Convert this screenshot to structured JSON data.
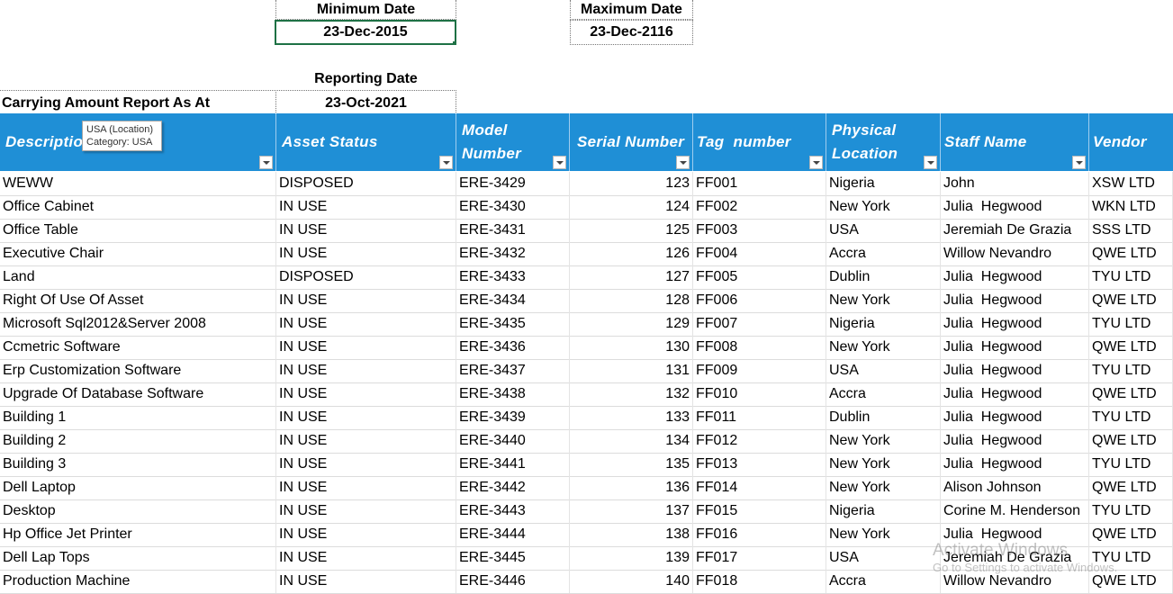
{
  "summary": {
    "min_date_label": "Minimum Date",
    "min_date_value": "23-Dec-2015",
    "max_date_label": "Maximum Date",
    "max_date_value": "23-Dec-2116",
    "reporting_date_label": "Reporting Date",
    "report_title": "Carrying Amount Report As At",
    "reporting_date_value": "23-Oct-2021"
  },
  "table": {
    "columns": [
      "Description",
      "Asset Status",
      "Model Number",
      "Serial Number",
      "Tag  number",
      "Physical Location",
      "Staff Name",
      "Vendor"
    ],
    "rows": [
      [
        "WEWW",
        "DISPOSED",
        "ERE-3429",
        "123",
        "FF001",
        "Nigeria",
        "John",
        "XSW LTD"
      ],
      [
        "Office Cabinet",
        "IN USE",
        "ERE-3430",
        "124",
        "FF002",
        "New York",
        "Julia  Hegwood",
        "WKN LTD"
      ],
      [
        "Office Table",
        "IN USE",
        "ERE-3431",
        "125",
        "FF003",
        "USA",
        "Jeremiah De Grazia",
        "SSS LTD"
      ],
      [
        "Executive Chair",
        "IN USE",
        "ERE-3432",
        "126",
        "FF004",
        "Accra",
        "Willow Nevandro",
        "QWE LTD"
      ],
      [
        "Land",
        "DISPOSED",
        "ERE-3433",
        "127",
        "FF005",
        "Dublin",
        "Julia  Hegwood",
        "TYU LTD"
      ],
      [
        "Right Of Use Of Asset",
        "IN USE",
        "ERE-3434",
        "128",
        "FF006",
        "New York",
        "Julia  Hegwood",
        "QWE LTD"
      ],
      [
        "Microsoft Sql2012&Server 2008",
        "IN USE",
        "ERE-3435",
        "129",
        "FF007",
        "Nigeria",
        "Julia  Hegwood",
        "TYU LTD"
      ],
      [
        "Ccmetric Software",
        "IN USE",
        "ERE-3436",
        "130",
        "FF008",
        "New York",
        "Julia  Hegwood",
        "QWE LTD"
      ],
      [
        "Erp Customization Software",
        "IN USE",
        "ERE-3437",
        "131",
        "FF009",
        "USA",
        "Julia  Hegwood",
        "TYU LTD"
      ],
      [
        "Upgrade Of Database Software",
        "IN USE",
        "ERE-3438",
        "132",
        "FF010",
        "Accra",
        "Julia  Hegwood",
        "QWE LTD"
      ],
      [
        "Building 1",
        "IN USE",
        "ERE-3439",
        "133",
        "FF011",
        "Dublin",
        "Julia  Hegwood",
        "TYU LTD"
      ],
      [
        "Building 2",
        "IN USE",
        "ERE-3440",
        "134",
        "FF012",
        "New York",
        "Julia  Hegwood",
        "QWE LTD"
      ],
      [
        "Building 3",
        "IN USE",
        "ERE-3441",
        "135",
        "FF013",
        "New York",
        "Julia  Hegwood",
        "TYU LTD"
      ],
      [
        "Dell Laptop",
        "IN USE",
        "ERE-3442",
        "136",
        "FF014",
        "New York",
        "Alison Johnson",
        "QWE LTD"
      ],
      [
        "Desktop",
        "IN USE",
        "ERE-3443",
        "137",
        "FF015",
        "Nigeria",
        "Corine M. Henderson",
        "TYU LTD"
      ],
      [
        "Hp Office Jet Printer",
        "IN USE",
        "ERE-3444",
        "138",
        "FF016",
        "New York",
        "Julia  Hegwood",
        "QWE LTD"
      ],
      [
        "Dell Lap Tops",
        "IN USE",
        "ERE-3445",
        "139",
        "FF017",
        "USA",
        "Jeremiah De Grazia",
        "TYU LTD"
      ],
      [
        "Production Machine",
        "IN USE",
        "ERE-3446",
        "140",
        "FF018",
        "Accra",
        "Willow Nevandro",
        "QWE LTD"
      ]
    ]
  },
  "tooltip": {
    "line1": "USA (Location)",
    "line2": "Category: USA"
  },
  "watermark": {
    "line1": "Activate Windows",
    "line2": "Go to Settings to activate Windows."
  },
  "colors": {
    "header_blue": "#1f8fd6",
    "selection_green": "#1e7145"
  }
}
